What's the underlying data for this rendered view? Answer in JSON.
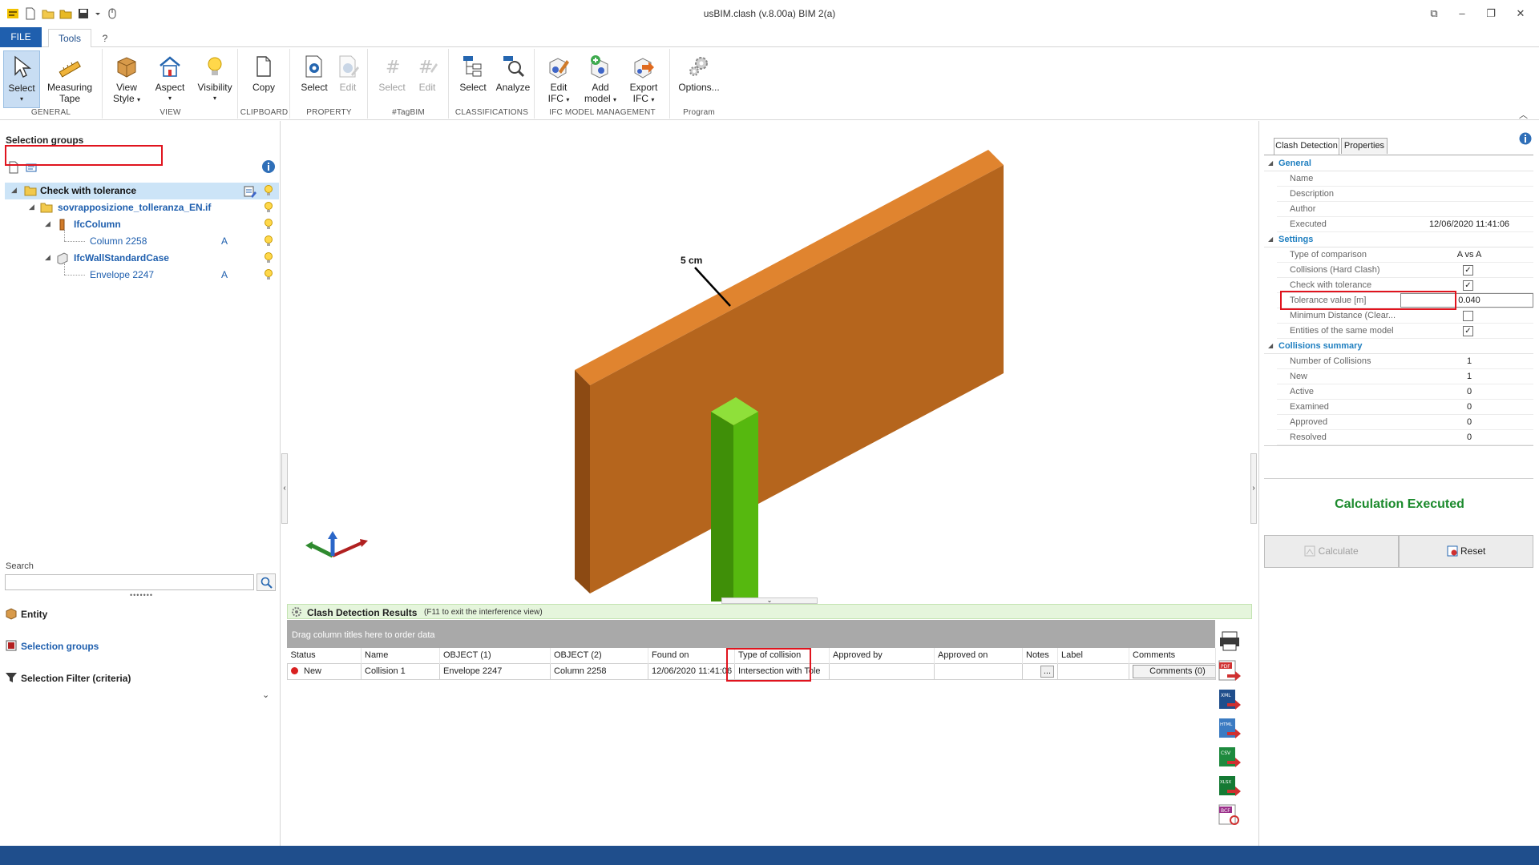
{
  "window": {
    "title": "usBIM.clash (v.8.00a)  BIM 2(a)"
  },
  "ribbon_tabs": {
    "file": "FILE",
    "tools": "Tools",
    "help": "?"
  },
  "ribbon": {
    "groups": {
      "general": "GENERAL",
      "view": "VIEW",
      "clipboard": "CLIPBOARD",
      "property": "PROPERTY",
      "tagbim": "#TagBIM",
      "classifications": "CLASSIFICATIONS",
      "ifc": "IFC MODEL MANAGEMENT",
      "program": "Program"
    },
    "buttons": {
      "select": "Select",
      "measuring_tape_1": "Measuring",
      "measuring_tape_2": "Tape",
      "view_style_1": "View",
      "view_style_2": "Style",
      "aspect": "Aspect",
      "visibility": "Visibility",
      "copy": "Copy",
      "prop_select": "Select",
      "prop_edit": "Edit",
      "tag_select": "Select",
      "tag_edit": "Edit",
      "class_select": "Select",
      "analyze": "Analyze",
      "edit_ifc_1": "Edit",
      "edit_ifc_2": "IFC",
      "add_model_1": "Add",
      "add_model_2": "model",
      "export_ifc_1": "Export",
      "export_ifc_2": "IFC",
      "options": "Options..."
    }
  },
  "left_panel": {
    "title": "Selection groups",
    "tree": {
      "root": "Check with tolerance",
      "file": "sovrapposizione_tolleranza_EN.if",
      "class1": "IfcColumn",
      "item1": "Column 2258",
      "item1_tag": "A",
      "class2": "IfcWallStandardCase",
      "item2": "Envelope 2247",
      "item2_tag": "A"
    },
    "search_label": "Search",
    "search_value": "",
    "nav": {
      "entity": "Entity",
      "selection_groups": "Selection groups",
      "selection_filter": "Selection Filter (criteria)"
    }
  },
  "viewport": {
    "dimension_label": "5 cm",
    "colors": {
      "wall_front": "#b5651d",
      "wall_top": "#e0842f",
      "wall_side": "#8c4a13",
      "column_front": "#56b80f",
      "column_top": "#8fe03a",
      "column_side": "#3f8f08"
    }
  },
  "results": {
    "title": "Clash Detection Results",
    "hint": "(F11 to exit the interference view)",
    "group_hint": "Drag column titles here to order data",
    "columns": [
      "Status",
      "Name",
      "OBJECT (1)",
      "OBJECT (2)",
      "Found on",
      "Type of collision",
      "Approved by",
      "Approved on",
      "Notes",
      "Label",
      "Comments"
    ],
    "rows": [
      {
        "status": "New",
        "name": "Collision 1",
        "object1": "Envelope 2247",
        "object2": "Column 2258",
        "found_on": "12/06/2020 11:41:06",
        "type": "Intersection with Tole",
        "approved_by": "",
        "approved_on": "",
        "notes": "...",
        "label": "",
        "comments": "Comments (0)"
      }
    ],
    "export_icons": [
      "print-icon",
      "pdf-export-icon",
      "xml-export-icon",
      "html-export-icon",
      "csv-export-icon",
      "xlsx-export-icon",
      "bcf-export-icon"
    ],
    "export_labels": {
      "pdf": "PDF",
      "xml": "XML",
      "html": "HTML",
      "csv": "CSV",
      "xlsx": "XLSX",
      "bcf": "BCF"
    }
  },
  "right_panel": {
    "tabs": {
      "clash": "Clash Detection",
      "properties": "Properties"
    },
    "general": {
      "label": "General",
      "name": "Name",
      "description": "Description",
      "author": "Author",
      "executed": "Executed",
      "executed_value": "12/06/2020 11:41:06"
    },
    "settings": {
      "label": "Settings",
      "type_of_comparison": "Type of comparison",
      "type_of_comparison_value": "A vs A",
      "hard_clash": "Collisions (Hard Clash)",
      "check_tolerance": "Check with tolerance",
      "tolerance_value": "Tolerance value [m]",
      "tolerance_value_value": "0.040",
      "minimum_distance": "Minimum Distance (Clear...",
      "same_model": "Entities of the same model"
    },
    "summary": {
      "label": "Collisions summary",
      "number": "Number of Collisions",
      "number_value": "1",
      "new": "New",
      "new_value": "1",
      "active": "Active",
      "active_value": "0",
      "examined": "Examined",
      "examined_value": "0",
      "approved": "Approved",
      "approved_value": "0",
      "resolved": "Resolved",
      "resolved_value": "0"
    },
    "status": "Calculation Executed",
    "calculate": "Calculate",
    "reset": "Reset"
  }
}
